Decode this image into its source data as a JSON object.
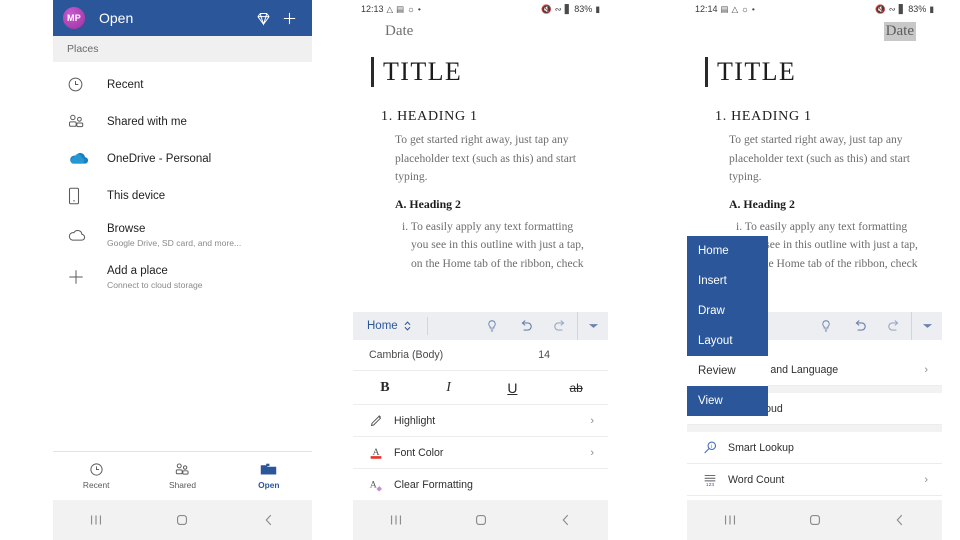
{
  "panel_open": {
    "appbar": {
      "avatar_initials": "MP",
      "title": "Open",
      "premium_icon": "diamond-icon",
      "add_icon": "plus-icon"
    },
    "section_header": "Places",
    "places": [
      {
        "icon": "clock-icon",
        "title": "Recent",
        "subtitle": ""
      },
      {
        "icon": "people-icon",
        "title": "Shared with me",
        "subtitle": ""
      },
      {
        "icon": "onedrive-icon",
        "title": "OneDrive - Personal",
        "subtitle": ""
      },
      {
        "icon": "phone-icon",
        "title": "This device",
        "subtitle": ""
      },
      {
        "icon": "cloud-icon",
        "title": "Browse",
        "subtitle": "Google Drive, SD card, and more..."
      },
      {
        "icon": "plus-icon",
        "title": "Add a place",
        "subtitle": "Connect to cloud storage"
      }
    ],
    "bottom_nav": [
      {
        "icon": "clock-icon",
        "label": "Recent",
        "active": false
      },
      {
        "icon": "people-icon",
        "label": "Shared",
        "active": false
      },
      {
        "icon": "folder-icon",
        "label": "Open",
        "active": true
      }
    ],
    "system_nav": [
      "recents-icon",
      "home-icon",
      "back-icon"
    ]
  },
  "panel_doc": {
    "status_bar": {
      "time": "12:13",
      "left_icons": [
        "drive-icon",
        "photos-icon",
        "messenger-icon",
        "dot-icon"
      ],
      "right_icons": [
        "mute-icon",
        "wifi-icon",
        "signal-icon"
      ],
      "battery": "83%"
    },
    "document": {
      "date": "Date",
      "title": "TITLE",
      "heading1": "1. HEADING 1",
      "body1": "To get started right away, just tap any placeholder text (such as this) and start typing.",
      "heading2": "A. Heading 2",
      "body2": "i. To easily apply any text formatting you see in this outline with just a tap, on the Home tab of the ribbon, check"
    },
    "ribbon": {
      "tab_label": "Home",
      "tab_expander_icon": "chevron-updown-icon",
      "tools": [
        "lightbulb-icon",
        "undo-icon",
        "redo-icon",
        "chevron-down-icon"
      ],
      "font_name": "Cambria (Body)",
      "font_size": "14",
      "style_buttons": [
        {
          "icon": "bold-icon",
          "label": "B"
        },
        {
          "icon": "italic-icon",
          "label": "I"
        },
        {
          "icon": "underline-icon",
          "label": "U"
        },
        {
          "icon": "strikethrough-icon",
          "label": "ab"
        }
      ],
      "items": [
        {
          "icon": "highlighter-icon",
          "label": "Highlight",
          "chevron": "›"
        },
        {
          "icon": "font-color-icon",
          "label": "Font Color",
          "chevron": "›"
        },
        {
          "icon": "clear-formatting-icon",
          "label": "Clear Formatting",
          "chevron": ""
        }
      ]
    },
    "system_nav": [
      "recents-icon",
      "home-icon",
      "back-icon"
    ]
  },
  "panel_menu": {
    "status_bar": {
      "time": "12:14",
      "left_icons": [
        "photos-icon",
        "drive-icon",
        "messenger-icon",
        "dot-icon"
      ],
      "right_icons": [
        "mute-icon",
        "wifi-icon",
        "signal-icon"
      ],
      "battery": "83%"
    },
    "document": {
      "date": "Date",
      "title": "TITLE",
      "heading1": "1. HEADING 1",
      "body1": "To get started right away, just tap any placeholder text (such as this) and start typing.",
      "heading2": "A. Heading 2",
      "body2": "i. To easily apply any text formatting you see in this outline with just a tap, on the Home tab of the ribbon, check"
    },
    "tab_menu": [
      {
        "label": "Home",
        "state": "normal"
      },
      {
        "label": "Insert",
        "state": "normal"
      },
      {
        "label": "Draw",
        "state": "normal"
      },
      {
        "label": "Layout",
        "state": "normal"
      },
      {
        "label": "Review",
        "state": "plain"
      },
      {
        "label": "View",
        "state": "selected"
      }
    ],
    "ribbon": {
      "tools": [
        "lightbulb-icon",
        "undo-icon",
        "redo-icon",
        "chevron-down-icon"
      ],
      "items": [
        {
          "icon": "proofing-icon",
          "label": "Proofing and Language",
          "chevron": "›"
        },
        {
          "icon": "read-aloud-icon",
          "label": "Read Aloud",
          "chevron": ""
        },
        {
          "icon": "smart-lookup-icon",
          "label": "Smart Lookup",
          "chevron": ""
        },
        {
          "icon": "word-count-icon",
          "label": "Word Count",
          "chevron": "›"
        }
      ]
    },
    "system_nav": [
      "recents-icon",
      "home-icon",
      "back-icon"
    ]
  },
  "colors": {
    "word_blue": "#2b579a",
    "avatar_purple": "#a0309e",
    "ribbon_grey": "#eceef1",
    "accent_red": "#e8362d"
  }
}
